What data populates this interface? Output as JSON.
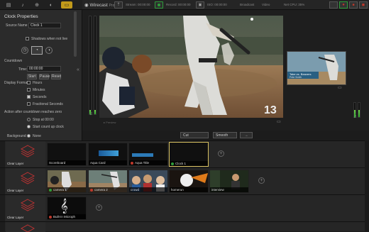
{
  "app": {
    "name": "Wirecast",
    "edition": "Pro"
  },
  "topbar": {
    "stats": [
      "Stream: 00:00:00",
      "Record: 00:00:00",
      "ISO: 00:00:00",
      "Broadcast",
      "Video",
      "Net CPU: 35%"
    ],
    "colors": {
      "record_green": "#2e9e3a",
      "live_red": "#c0392b",
      "accent": "#c29a1a"
    }
  },
  "left": {
    "title": "Clock Properties",
    "source_name_label": "Source Name",
    "source_name_value": "Clock 1",
    "shadow_label": "Shadows when not live",
    "countdown_label": "Countdown",
    "time_label": "Time:",
    "time_value": "00:00:00",
    "start_label": "Start",
    "pause_label": "Pause",
    "reset_label": "Reset",
    "display_format_label": "Display Format",
    "format_options": [
      "Hours",
      "Minutes",
      "Seconds",
      "Fractional Seconds"
    ],
    "action_label": "Action after countdown reaches zero",
    "action_options": [
      "Stop at 00:00",
      "Start count up clock"
    ],
    "background_label": "Background",
    "background_value": "None"
  },
  "preview": {
    "jersey_number": "13"
  },
  "live": {
    "lower_third_name": "Take vs. Beavers",
    "lower_third_sub": "Pete Smith"
  },
  "controls": {
    "transition": "Cut",
    "speed": "Smooth",
    "go_label": "→"
  },
  "rows": [
    {
      "layer_label": "Clear Layer",
      "shots": [
        {
          "label": "Scoreboard",
          "dot": ""
        },
        {
          "label": "Aqua Card",
          "dot": ""
        },
        {
          "label": "Aqua Title",
          "dot": "#c0392b"
        },
        {
          "label": "Clock 1",
          "dot": "#2e9e3a"
        }
      ]
    },
    {
      "layer_label": "Clear Layer",
      "shots": [
        {
          "label": "camera 1",
          "dot": "#2e9e3a"
        },
        {
          "label": "camera 2",
          "dot": "#c0392b"
        },
        {
          "label": "crowd",
          "dot": ""
        },
        {
          "label": "homerun",
          "dot": ""
        },
        {
          "label": "interview",
          "dot": ""
        }
      ]
    },
    {
      "layer_label": "Clear Layer",
      "shots": [
        {
          "label": "Built-in Microph",
          "dot": "#c0392b"
        }
      ]
    }
  ]
}
